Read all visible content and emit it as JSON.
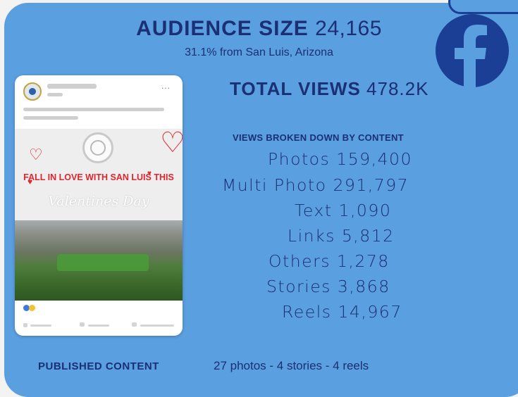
{
  "audience": {
    "label": "AUDIENCE SIZE",
    "value": "24,165",
    "subtitle": "31.1% from San Luis, Arizona"
  },
  "total_views": {
    "label": "TOTAL VIEWS",
    "value": "478.2K"
  },
  "breakdown": {
    "heading": "VIEWS BROKEN DOWN BY CONTENT",
    "rows": [
      {
        "label": "Photos",
        "value": "159,400"
      },
      {
        "label": "Multi Photo",
        "value": "291,797"
      },
      {
        "label": "Text",
        "value": "1,090"
      },
      {
        "label": "Links",
        "value": "5,812"
      },
      {
        "label": "Others",
        "value": "1,278"
      },
      {
        "label": "Stories",
        "value": "3,868"
      },
      {
        "label": "Reels",
        "value": "14,967"
      }
    ]
  },
  "published": {
    "label": "PUBLISHED CONTENT",
    "value": "27 photos - 4 stories - 4 reels"
  },
  "post_preview": {
    "headline": "FALL IN LOVE WITH SAN LUIS THIS",
    "script_text": "Valentines Day",
    "menu": "..."
  },
  "icons": {
    "brand": "facebook-icon"
  },
  "colors": {
    "background": "#5a9fe0",
    "text": "#1b2f74",
    "facebook": "#1b3f95",
    "accent_red": "#e0262c"
  }
}
